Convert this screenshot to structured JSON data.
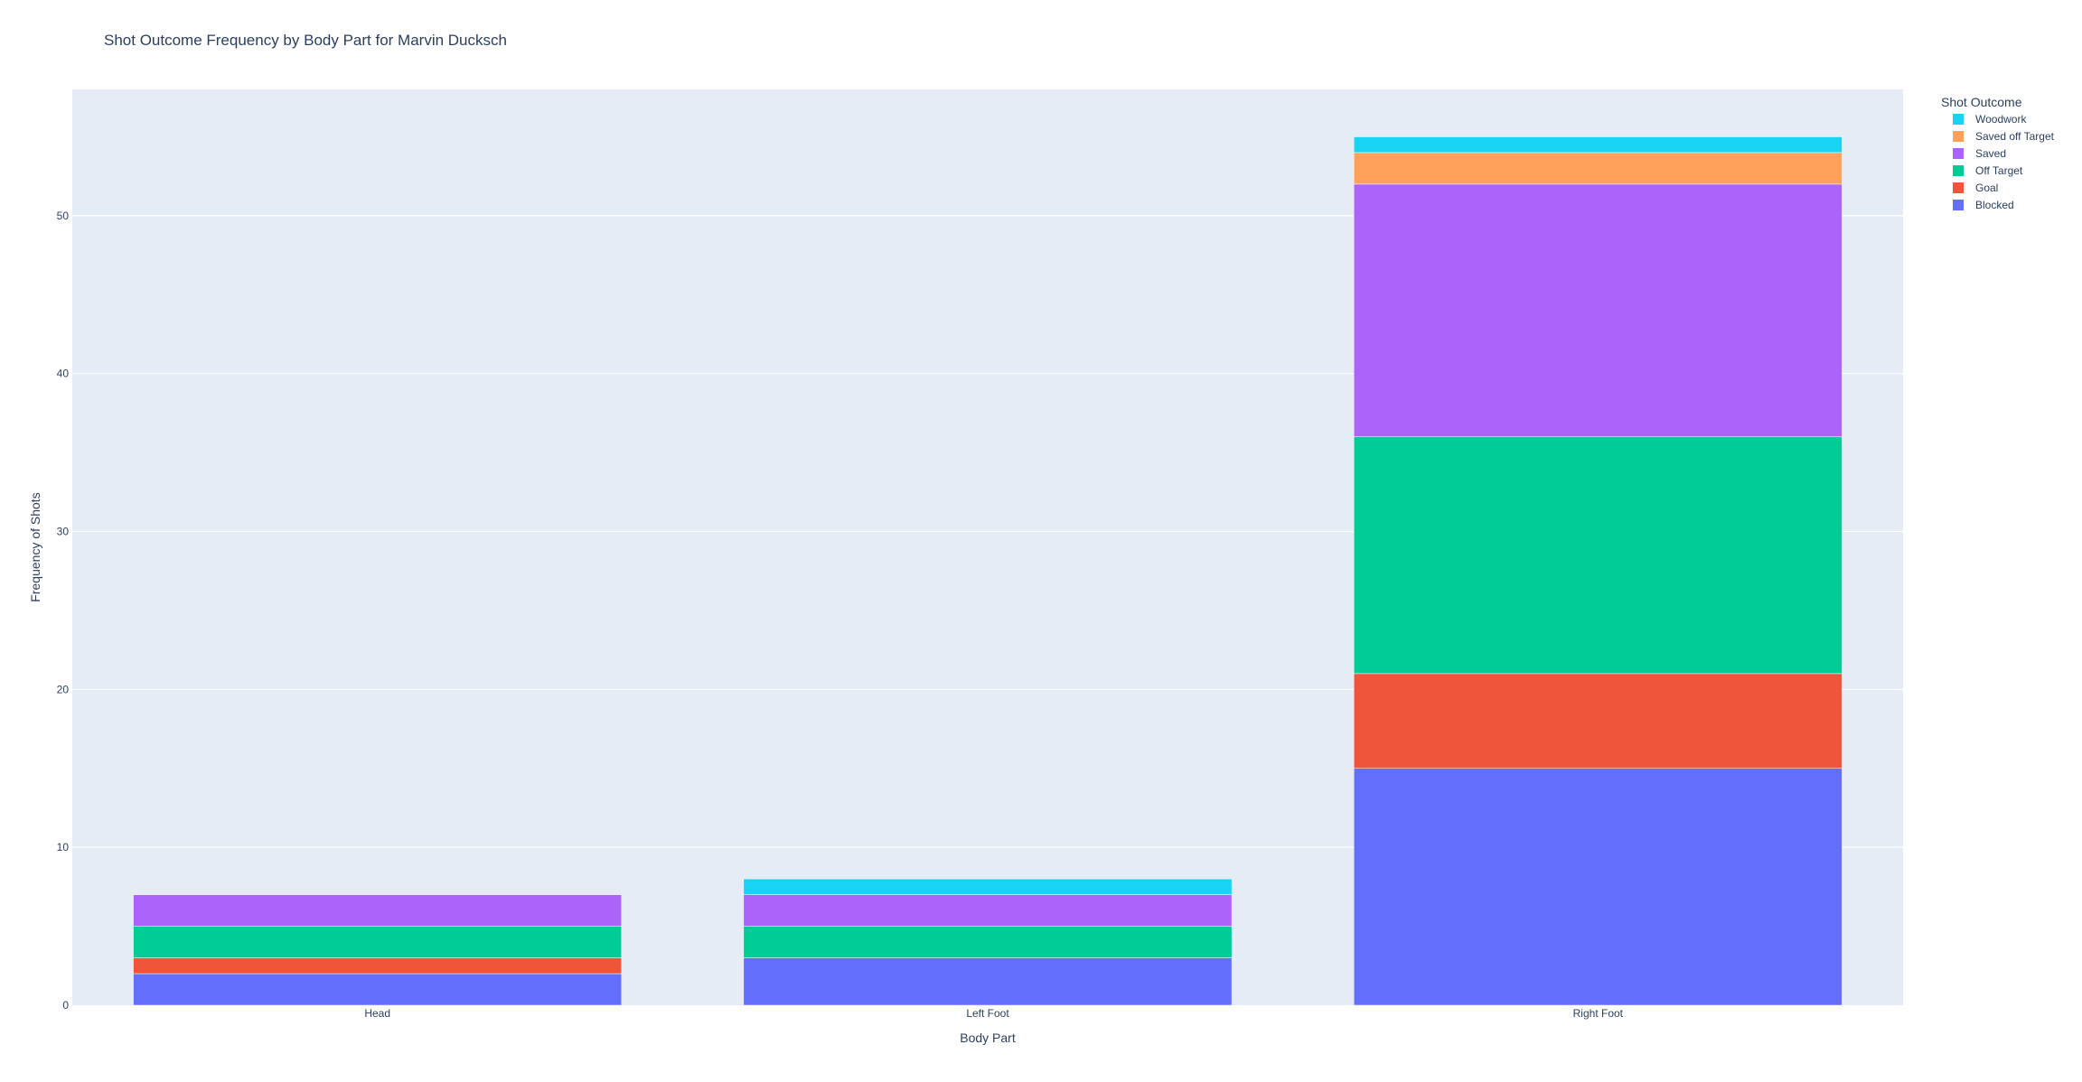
{
  "chart_data": {
    "type": "bar",
    "barmode": "stack",
    "title": "Shot Outcome Frequency by Body Part for Marvin Ducksch",
    "xlabel": "Body Part",
    "ylabel": "Frequency of Shots",
    "categories": [
      "Head",
      "Left Foot",
      "Right Foot"
    ],
    "ylim": [
      0,
      58
    ],
    "yticks": [
      0,
      10,
      20,
      30,
      40,
      50
    ],
    "grid": true,
    "legend": {
      "title": "Shot Outcome",
      "placement": "top-right",
      "order": [
        "Woodwork",
        "Saved off Target",
        "Saved",
        "Off Target",
        "Goal",
        "Blocked"
      ]
    },
    "series": [
      {
        "name": "Blocked",
        "values": [
          2,
          3,
          15
        ],
        "color": "#636efa"
      },
      {
        "name": "Goal",
        "values": [
          1,
          0,
          6
        ],
        "color": "#ef553b"
      },
      {
        "name": "Off Target",
        "values": [
          2,
          2,
          15
        ],
        "color": "#00cc96"
      },
      {
        "name": "Saved",
        "values": [
          2,
          2,
          16
        ],
        "color": "#ab63fa"
      },
      {
        "name": "Saved off Target",
        "values": [
          0,
          0,
          2
        ],
        "color": "#ffa15a"
      },
      {
        "name": "Woodwork",
        "values": [
          0,
          1,
          1
        ],
        "color": "#19d3f3"
      }
    ],
    "colors": {
      "plot_background": "#e5ecf6",
      "gridline": "#ffffff",
      "text": "#2a3f5f"
    }
  }
}
